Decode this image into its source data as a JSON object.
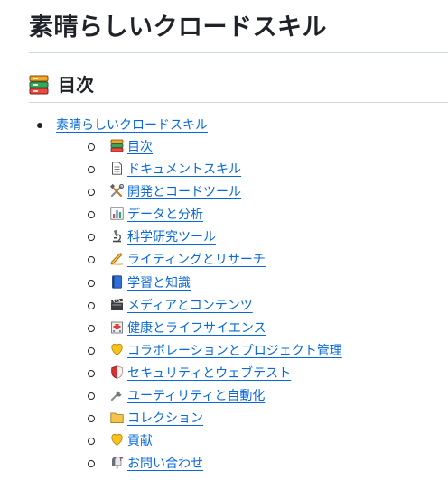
{
  "page": {
    "title": "素晴らしいクロードスキル",
    "toc_heading": "目次",
    "toc_heading_icon": "books-icon"
  },
  "toc": {
    "root": {
      "label": "素晴らしいクロードスキル"
    },
    "items": [
      {
        "label": "目次",
        "icon": "books-icon"
      },
      {
        "label": "ドキュメントスキル",
        "icon": "document-icon"
      },
      {
        "label": "開発とコードツール",
        "icon": "tools-icon"
      },
      {
        "label": "データと分析",
        "icon": "bar-chart-icon"
      },
      {
        "label": "科学研究ツール",
        "icon": "microscope-icon"
      },
      {
        "label": "ライティングとリサーチ",
        "icon": "pencil-writing-icon"
      },
      {
        "label": "学習と知識",
        "icon": "blue-book-icon"
      },
      {
        "label": "メディアとコンテンツ",
        "icon": "clapper-icon"
      },
      {
        "label": "健康とライフサイエンス",
        "icon": "hospital-icon"
      },
      {
        "label": "コラボレーションとプロジェクト管理",
        "icon": "yellow-heart-icon"
      },
      {
        "label": "セキュリティとウェブテスト",
        "icon": "shield-icon"
      },
      {
        "label": "ユーティリティと自動化",
        "icon": "wrench-icon"
      },
      {
        "label": "コレクション",
        "icon": "folder-icon"
      },
      {
        "label": "貢献",
        "icon": "yellow-heart-icon"
      },
      {
        "label": "お問い合わせ",
        "icon": "mailbox-icon"
      }
    ]
  },
  "colors": {
    "link": "#0969da",
    "text": "#1f2328",
    "divider": "#d1d9e0"
  }
}
